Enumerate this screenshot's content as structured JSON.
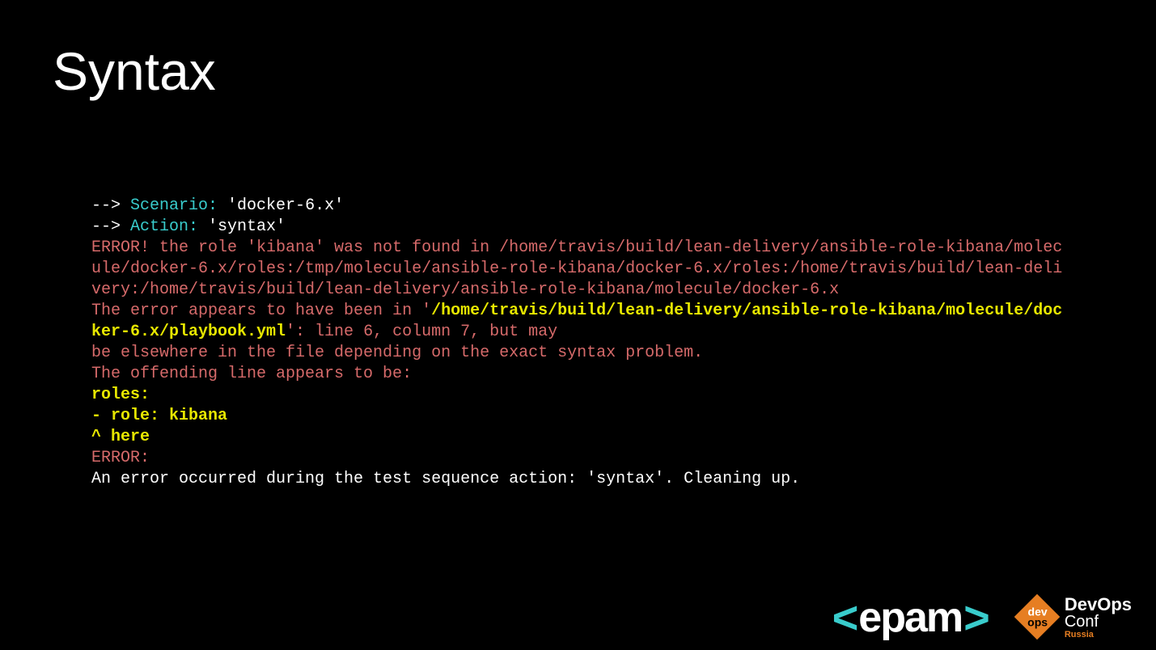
{
  "title": "Syntax",
  "terminal": {
    "arrow": "--> ",
    "scenario_key": "Scenario: ",
    "scenario_val": "'docker-6.x'",
    "action_key": "Action: ",
    "action_val": "'syntax'",
    "error1": "ERROR! the role 'kibana' was not found in /home/travis/build/lean-delivery/ansible-role-kibana/molecule/docker-6.x/roles:/tmp/molecule/ansible-role-kibana/docker-6.x/roles:/home/travis/build/lean-delivery:/home/travis/build/lean-delivery/ansible-role-kibana/molecule/docker-6.x",
    "appears_pre": "The error appears to have been in '",
    "appears_path": "/home/travis/build/lean-delivery/ansible-role-kibana/molecule/docker-6.x/playbook.yml",
    "appears_post": "': line 6, column 7, but may",
    "elsewhere": "be elsewhere in the file depending on the exact syntax problem.",
    "offending": "The offending line appears to be:",
    "roles": "roles:",
    "role_line": "- role: kibana",
    "here": "^ here",
    "error_label": "ERROR:",
    "finalmsg": "An error occurred during the test sequence action: 'syntax'. Cleaning up."
  },
  "logos": {
    "epam_left": "<",
    "epam_name": "epam",
    "epam_right": ">",
    "do_box_dev": "dev",
    "do_box_ops": "ops",
    "do_devops": "DevOps",
    "do_conf": "Conf",
    "do_russia": "Russia"
  }
}
